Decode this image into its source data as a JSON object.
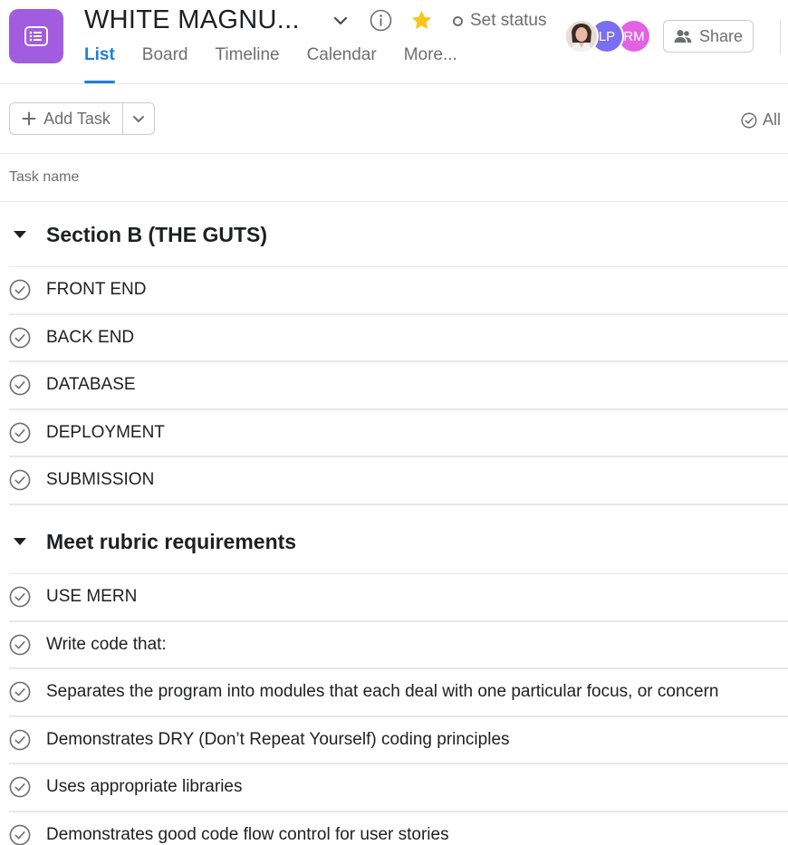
{
  "header": {
    "project_title": "WHITE MAGNU...",
    "set_status_label": "Set status",
    "tabs": [
      {
        "label": "List",
        "active": true
      },
      {
        "label": "Board",
        "active": false
      },
      {
        "label": "Timeline",
        "active": false
      },
      {
        "label": "Calendar",
        "active": false
      },
      {
        "label": "More...",
        "active": false
      }
    ],
    "avatars": [
      {
        "initials": "",
        "kind": "photo"
      },
      {
        "initials": "LP",
        "color": "#7a6ff0"
      },
      {
        "initials": "RM",
        "color": "#e362e3"
      }
    ],
    "share_label": "Share"
  },
  "toolbar": {
    "add_task_label": "Add Task",
    "filter_label": "All"
  },
  "table": {
    "column_task_name": "Task name"
  },
  "sections": [
    {
      "title": "Section B (THE GUTS)",
      "tasks": [
        "FRONT END",
        "BACK END",
        "DATABASE",
        "DEPLOYMENT",
        "SUBMISSION"
      ]
    },
    {
      "title": "Meet rubric requirements",
      "tasks": [
        "USE MERN",
        "Write code that:",
        "Separates the program into modules that each deal with one particular focus, or concern",
        "Demonstrates DRY (Don’t Repeat Yourself) coding principles",
        "Uses appropriate libraries",
        "Demonstrates good code flow control for user stories"
      ]
    }
  ],
  "colors": {
    "project_icon": "#a25ce0",
    "active_tab": "#1f7fd8",
    "star": "#f8c51c"
  },
  "icons": {
    "project": "list-icon",
    "title_dropdown": "chevron-down-icon",
    "info": "info-icon",
    "star": "star-icon",
    "share": "people-icon",
    "add": "plus-icon",
    "filter": "check-circle-icon",
    "section_toggle": "caret-down-icon",
    "task_complete": "check-circle-icon"
  }
}
